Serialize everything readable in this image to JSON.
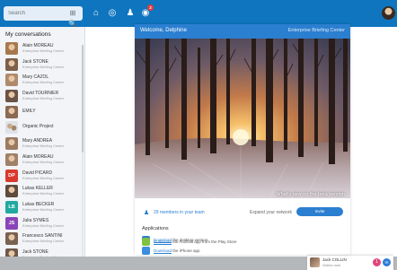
{
  "topbar": {
    "search_placeholder": "Search",
    "nav_icons": [
      "home-icon",
      "compass-icon",
      "contacts-icon",
      "notifications-icon"
    ],
    "notification_count": "2"
  },
  "sidebar": {
    "title": "My conversations",
    "conversations": [
      {
        "name": "Alain MOREAU",
        "sub": "Enterprise Briefing Center",
        "avatar": "photo",
        "color": "#a7784e"
      },
      {
        "name": "Jack STONE",
        "sub": "Enterprise Briefing Center",
        "avatar": "photo",
        "color": "#7d5f4a"
      },
      {
        "name": "Mary CAZOL",
        "sub": "Enterprise Briefing Center",
        "avatar": "photo",
        "color": "#b08a6c"
      },
      {
        "name": "David TOURNIER",
        "sub": "Enterprise Briefing Center",
        "avatar": "photo",
        "color": "#6b5446"
      },
      {
        "name": "EMILY",
        "sub": "",
        "avatar": "photo",
        "color": "#8c6a52"
      },
      {
        "name": "Organic Project",
        "sub": "",
        "avatar": "group",
        "color": "#7e8a96"
      },
      {
        "name": "Mary ANDREA",
        "sub": "Enterprise Briefing Center",
        "avatar": "photo",
        "color": "#9c7a62"
      },
      {
        "name": "Alain MOREAU",
        "sub": "Enterprise Briefing Center",
        "avatar": "photo",
        "color": "#a08066"
      },
      {
        "name": "David PICARD",
        "sub": "Enterprise Briefing Center",
        "avatar": "initials",
        "initials": "DP",
        "color": "#d9382f"
      },
      {
        "name": "Lukas KELLER",
        "sub": "Enterprise Briefing Center",
        "avatar": "photo",
        "color": "#5e4a3e"
      },
      {
        "name": "Lukas BECKER",
        "sub": "Enterprise Briefing Center",
        "avatar": "initials",
        "initials": "LB",
        "color": "#20a9a0"
      },
      {
        "name": "Julia SYMES",
        "sub": "Enterprise Briefing Center",
        "avatar": "initials",
        "initials": "JS",
        "color": "#8a44b8"
      },
      {
        "name": "Francesco SANTINI",
        "sub": "Enterprise Briefing Center",
        "avatar": "photo",
        "color": "#7a6250"
      },
      {
        "name": "Jack STONE",
        "sub": "Enterprise Briefing Center",
        "avatar": "photo",
        "color": "#6e5848"
      }
    ]
  },
  "card": {
    "welcome": "Welcome, Delphine",
    "brand": "Enterprise Briefing Center",
    "photo_caption": "What's new on the beta version",
    "contacts_link": "29 members in your team",
    "expand_label": "Expand your network",
    "invite_button": "Invite",
    "apps_title": "Applications",
    "apps": [
      {
        "text_link": "Download",
        "text_rest": " the desktop version",
        "icon": "windows-icon",
        "color": "#2b7fd0"
      },
      {
        "text_link": "Download",
        "text_rest": " the iPhone app",
        "icon": "appstore-icon",
        "color": "#3a8fe0"
      },
      {
        "text_link": "Download",
        "text_rest": " the Android app from the Play Store",
        "icon": "android-icon",
        "color": "#7fc242"
      }
    ]
  },
  "chat_chip": {
    "name": "Jack COLLIN",
    "status": "Online now",
    "badge": "1",
    "action_icon": "chat-icon"
  },
  "colors": {
    "brand_blue": "#0f75bf",
    "header_blue": "#2b7fd0",
    "sidebar_bg": "#f2f4f7"
  }
}
